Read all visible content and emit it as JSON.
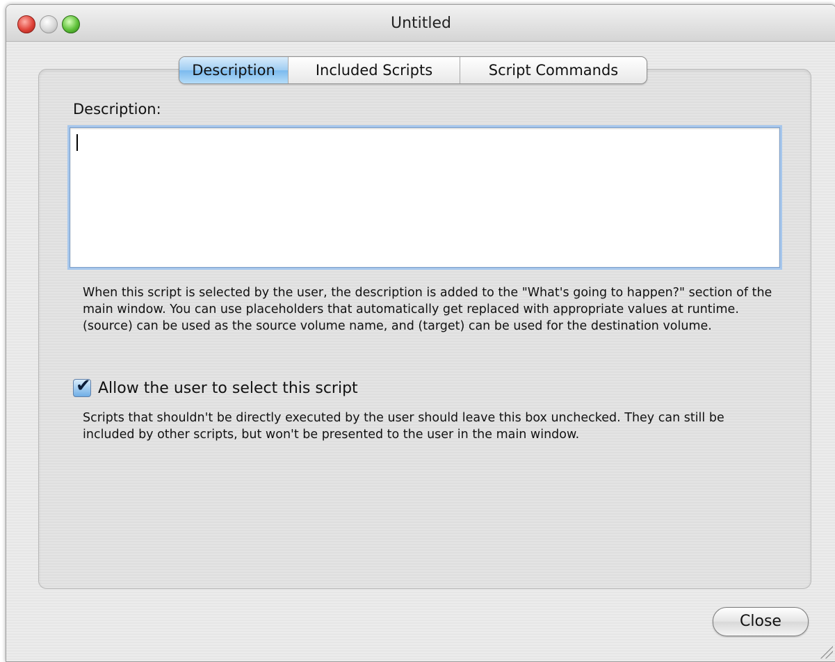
{
  "window": {
    "title": "Untitled"
  },
  "tabs": [
    {
      "label": "Description",
      "active": true
    },
    {
      "label": "Included Scripts",
      "active": false
    },
    {
      "label": "Script Commands",
      "active": false
    }
  ],
  "description": {
    "label": "Description:",
    "value": "",
    "help": "When this script is selected by the user, the description is added to the \"What's going to happen?\" section of the main window. You can use placeholders that automatically get replaced with appropriate values at runtime. (source) can be used as the source volume name, and (target) can be used for the destination volume."
  },
  "allow_select": {
    "label": "Allow the user to select this script",
    "checked": true,
    "help": "Scripts that shouldn't be directly executed by the user should leave this box unchecked. They can still be included by other scripts, but won't be presented to the user in the main window."
  },
  "buttons": {
    "close_label": "Close"
  },
  "icons": {
    "close": "close-window-icon",
    "minimize": "minimize-window-icon",
    "zoom": "zoom-window-icon",
    "checkbox": "checkmark-icon",
    "grip": "resize-grip-icon"
  },
  "colors": {
    "active_tab": "#9fcdf2",
    "focus_ring": "#a7c7ec",
    "close_light": "#e0443a",
    "zoom_light": "#5fc13a"
  }
}
